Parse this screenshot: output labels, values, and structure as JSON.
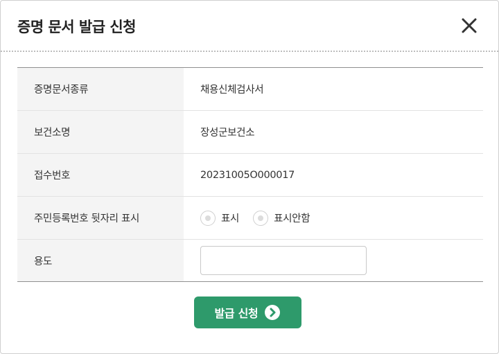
{
  "dialog": {
    "title": "증명 문서 발급 신청",
    "close_icon": "close-icon"
  },
  "form": {
    "rows": [
      {
        "label": "증명문서종류",
        "value": "채용신체검사서"
      },
      {
        "label": "보건소명",
        "value": "장성군보건소"
      },
      {
        "label": "접수번호",
        "value": "20231005O000017"
      },
      {
        "label": "주민등록번호 뒷자리 표시",
        "options": [
          "표시",
          "표시안함"
        ]
      },
      {
        "label": "용도",
        "input_value": ""
      }
    ]
  },
  "submit": {
    "label": "발급 신청",
    "icon": "arrow-right-circle-icon"
  },
  "colors": {
    "accent": "#2e9a6b",
    "label_bg": "#f4f4f4",
    "text": "#333333"
  }
}
